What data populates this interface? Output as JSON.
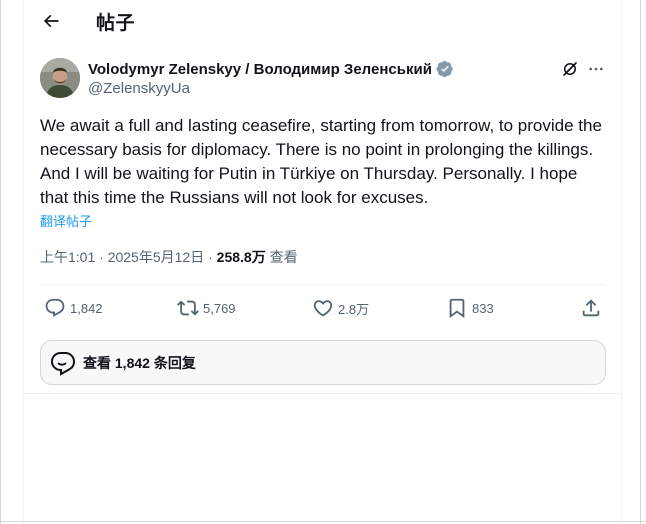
{
  "header": {
    "title": "帖子",
    "back_icon": "arrow-left-icon"
  },
  "author": {
    "name": "Volodymyr Zelenskyy / Володимир Зеленський",
    "handle": "@ZelenskyyUa",
    "verified": true,
    "verified_color": "#829aab"
  },
  "post": {
    "text": "We await a full and lasting ceasefire, starting from tomorrow, to provide the necessary basis for diplomacy. There is no point in prolonging the killings. And I will be waiting for Putin in Türkiye on Thursday. Personally. I hope that this time the Russians will not look for excuses.",
    "translate_label": "翻译帖子",
    "time": "上午1:01",
    "date": "2025年5月12日",
    "separator": "·",
    "views_count": "258.8万",
    "views_label": "查看"
  },
  "actions": {
    "replies": "1,842",
    "reposts": "5,769",
    "likes": "2.8万",
    "bookmarks": "833"
  },
  "replies_button": {
    "label": "查看 1,842 条回复"
  },
  "colors": {
    "link": "#1d9bf0",
    "secondary_text": "#536471",
    "border": "#cfd9de"
  }
}
